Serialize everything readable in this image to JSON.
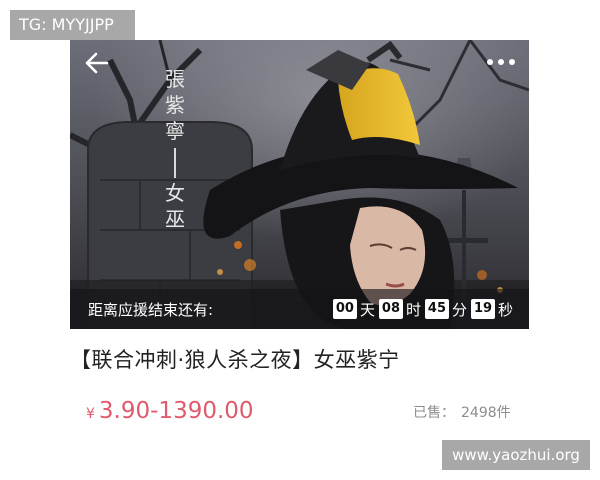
{
  "overlay": {
    "tg_label": "TG: MYYJJPP",
    "watermark": "www.yaozhui.org"
  },
  "hero": {
    "vertical_title": "張紫寧",
    "vertical_role": "女巫",
    "countdown": {
      "label": "距离应援结束还有:",
      "days": "00",
      "days_unit": "天",
      "hours": "08",
      "hours_unit": "时",
      "minutes": "45",
      "minutes_unit": "分",
      "seconds": "19",
      "seconds_unit": "秒"
    },
    "icons": {
      "back": "back-arrow-icon",
      "more": "more-dots-icon"
    }
  },
  "product": {
    "title": "【联合冲刺·狼人杀之夜】女巫紫宁",
    "price_currency": "¥",
    "price_range": "3.90-1390.00",
    "sold_label": "已售：",
    "sold_count": "2498件"
  },
  "colors": {
    "price": "#e05a6d",
    "countdown_bar": "#141418",
    "badge_bg": "#a8a8a8"
  }
}
